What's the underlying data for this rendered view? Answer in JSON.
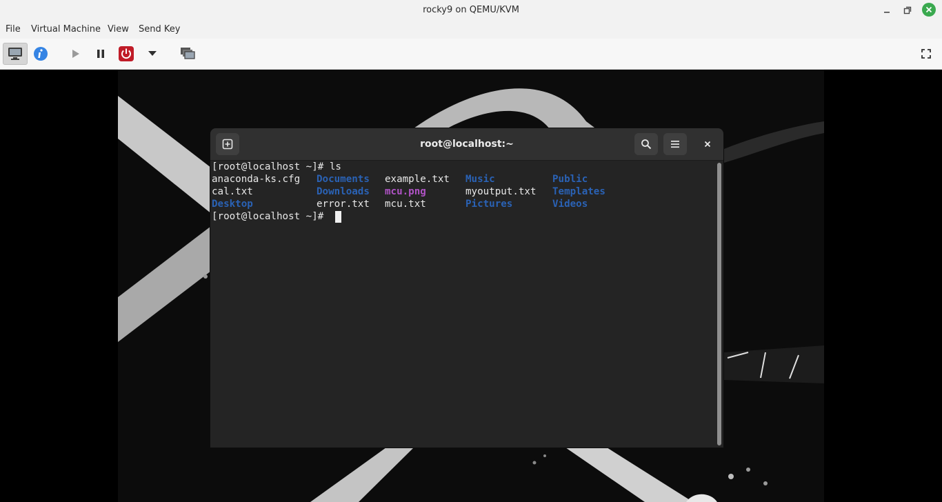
{
  "window": {
    "title": "rocky9 on QEMU/KVM",
    "controls": [
      "minimize-icon",
      "maximize-icon",
      "close-icon"
    ]
  },
  "menubar": {
    "items": [
      "File",
      "Virtual Machine",
      "View",
      "Send Key"
    ]
  },
  "toolbar": {
    "buttons": [
      "console-icon",
      "info-icon",
      "play-icon",
      "pause-icon",
      "power-icon",
      "chevron-down-icon",
      "snapshots-icon",
      "fullscreen-icon"
    ],
    "colors": {
      "info": "#3584e4",
      "power": "#c01c28"
    }
  },
  "terminal": {
    "title": "root@localhost:~",
    "prompt_line": "[root@localhost ~]# ls",
    "final_prompt": "[root@localhost ~]#",
    "listing": [
      [
        "anaconda-ks.cfg",
        "Documents",
        "example.txt",
        "Music",
        "Public"
      ],
      [
        "cal.txt",
        "Downloads",
        "mcu.png",
        "myoutput.txt",
        "Templates"
      ],
      [
        "Desktop",
        "error.txt",
        "mcu.txt",
        "Pictures",
        "Videos"
      ]
    ],
    "colors": {
      "directory": "#2a62b5",
      "image": "#b053c6",
      "text": "#e8e8e8",
      "background": "#242424"
    }
  }
}
